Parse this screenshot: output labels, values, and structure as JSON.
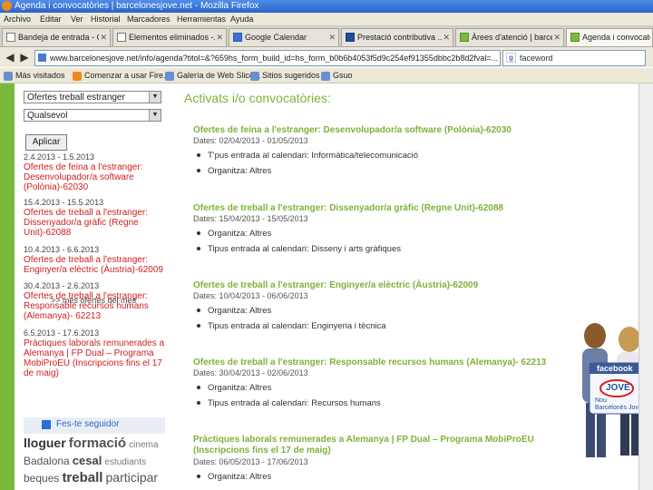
{
  "window": {
    "title": "Agenda i convocatòries | barcelonesjove.net - Mozilla Firefox"
  },
  "menu": [
    "Archivo",
    "Editar",
    "Ver",
    "Historial",
    "Marcadores",
    "Herramientas",
    "Ayuda"
  ],
  "tabs": [
    {
      "label": "Bandeja de entrada - O..."
    },
    {
      "label": "Elementos eliminados -..."
    },
    {
      "label": "Google Calendar"
    },
    {
      "label": "Prestació contributiva ..."
    },
    {
      "label": "Àrees d'atenció | barce..."
    },
    {
      "label": "Agenda i convocatòries ..."
    }
  ],
  "address": {
    "url": "www.barcelonesjove.net/info/agenda?titol=&?659hs_form_build_id=hs_form_b0b6b4053f5d9c254ef91355dbbc2b8d2fval=..."
  },
  "search": {
    "engine_icon": "google-icon",
    "value": "faceword"
  },
  "bookmarks": [
    "Más visitados",
    "Comenzar a usar Fire...",
    "Galería de Web Slice...",
    "Sitios sugeridos",
    "Gsuo"
  ],
  "filters": {
    "category": "Ofertes treball estranger",
    "location": "Qualsevol",
    "apply_label": "Aplicar"
  },
  "left_list": [
    {
      "dates": "2.4.2013 - 1.5.2013",
      "title": "Ofertes de feina a l'estranger: Desenvolupador/a software (Polònia)-62030"
    },
    {
      "dates": "15.4.2013 - 15.5.2013",
      "title": "Ofertes de treball a l'estranger: Dissenyador/a gràfic (Regne Unit)-62088"
    },
    {
      "dates": "10.4.2013 - 6.6.2013",
      "title": "Ofertes de treball a l'estranger: Enginyer/a elèctric (Àustria)-62009"
    },
    {
      "dates": "30.4.2013 - 2.6.2013",
      "title": "Ofertes de treball a l'estranger: Responsable recursos humans (Alemanya)- 62213"
    },
    {
      "dates": "6.5.2013 - 17.6.2013",
      "title": "Pràctiques laborals remunerades a Alemanya | FP Dual – Programa MobiProEU (Inscripcions fins el 17 de maig)"
    }
  ],
  "more_link": ">> més ofertes del mes",
  "follow_label": "Fes-te seguidor",
  "tags": [
    {
      "text": "lloguer",
      "size": 14,
      "color": "#333333"
    },
    {
      "text": "formació",
      "size": 15,
      "color": "#555555"
    },
    {
      "text": "cinema",
      "size": 10,
      "color": "#777777"
    },
    {
      "text": "Badalona",
      "size": 12,
      "color": "#555555"
    },
    {
      "text": "cesal",
      "size": 13,
      "color": "#444444"
    },
    {
      "text": "estudiants",
      "size": 10,
      "color": "#777777"
    },
    {
      "text": "beques",
      "size": 12,
      "color": "#555555"
    },
    {
      "text": "treball",
      "size": 15,
      "color": "#444444"
    },
    {
      "text": "participar",
      "size": 14,
      "color": "#555555"
    }
  ],
  "main": {
    "heading": "Activats i/o convocatòries:",
    "entries": [
      {
        "title": "Ofertes de feina a l'estranger: Desenvolupador/a software (Polònia)-62030",
        "dates": "Dates: 02/04/2013 - 01/05/2013",
        "items": [
          "T'pus entrada al calendari: Informàtica/telecomunicació",
          "Organitza: Altres"
        ]
      },
      {
        "title": "Ofertes de treball a l'estranger: Dissenyador/a gràfic (Regne Unit)-62088",
        "dates": "Dates: 15/04/2013 - 15/05/2013",
        "items": [
          "Organitza: Altres",
          "Tipus entrada al calendari: Disseny i arts gràfiques"
        ]
      },
      {
        "title": "Ofertes de treball a l'estranger: Enginyer/a elèctric (Àustria)-62009",
        "dates": "Dates: 10/04/2013 - 06/06/2013",
        "items": [
          "Organitza: Altres",
          "Tipus entrada al calendari: Enginyeria i tècnica"
        ]
      },
      {
        "title": "Ofertes de treball a l'estranger: Responsable recursos humans (Alemanya)- 62213",
        "dates": "Dates: 30/04/2013 - 02/06/2013",
        "items": [
          "Organitza: Altres",
          "Tipus entrada al calendari: Recursos humans"
        ]
      },
      {
        "title": "Pràctiques laborals remunerades a Alemanya | FP Dual – Programa MobiProEU (Inscripcions fins el 17 de maig)",
        "dates": "Dates: 06/05/2013 - 17/06/2013",
        "items": [
          "Organitza: Altres"
        ]
      }
    ]
  },
  "promo": {
    "facebook": "facebook",
    "badge": "JOVE",
    "tagline1": "Nou",
    "tagline2": "Barcelonès Jove"
  }
}
